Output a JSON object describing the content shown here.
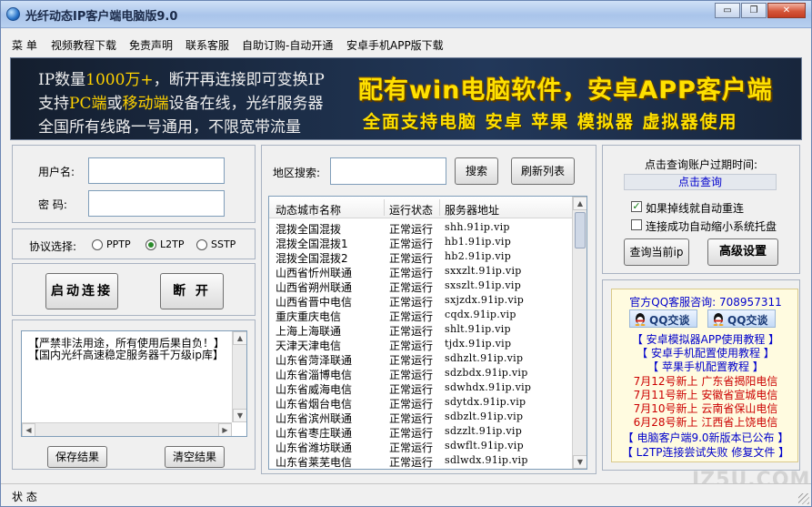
{
  "window": {
    "title": "光纤动态IP客户端电脑版9.0",
    "controls": [
      "▭",
      "❐",
      "✕"
    ]
  },
  "menu": [
    "菜 单",
    "视频教程下载",
    "免责声明",
    "联系客服",
    "自助订购-自动开通",
    "安卓手机APP版下载"
  ],
  "banner": {
    "line1_a": "IP数量",
    "line1_hl": "1000万+",
    "line1_b": "，断开再连接即可变换IP",
    "line2_a": "支持",
    "line2_hl1": "PC端",
    "line2_b": "或",
    "line2_hl2": "移动端",
    "line2_c": "设备在线，光纤服务器",
    "line3": "全国所有线路一号通用，不限宽带流量",
    "headline": "配有win电脑软件，安卓APP客户端",
    "subline": "全面支持电脑 安卓 苹果 模拟器 虚拟器使用"
  },
  "login": {
    "username_label": "用户名:",
    "username_value": "",
    "password_label": "密  码:",
    "password_value": ""
  },
  "protocol": {
    "label": "协议选择:",
    "options": [
      {
        "label": "PPTP",
        "checked": false
      },
      {
        "label": "L2TP",
        "checked": true
      },
      {
        "label": "SSTP",
        "checked": false
      }
    ]
  },
  "actions": {
    "connect": "启动连接",
    "disconnect": "断 开",
    "save": "保存结果",
    "clear": "清空结果"
  },
  "log": [
    "【严禁非法用途，所有使用后果自负！】",
    "【国内光纤高速稳定服务器千万级ip库】"
  ],
  "search": {
    "label": "地区搜索:",
    "value": "",
    "search_button": "搜索",
    "refresh_button": "刷新列表"
  },
  "servers": {
    "columns": [
      "动态城市名称",
      "运行状态",
      "服务器地址"
    ],
    "rows": [
      [
        "混拨全国混拨",
        "正常运行",
        "shh.91ip.vip"
      ],
      [
        "混拨全国混拨1",
        "正常运行",
        "hb1.91ip.vip"
      ],
      [
        "混拨全国混拨2",
        "正常运行",
        "hb2.91ip.vip"
      ],
      [
        "山西省忻州联通",
        "正常运行",
        "sxxzlt.91ip.vip"
      ],
      [
        "山西省朔州联通",
        "正常运行",
        "sxszlt.91ip.vip"
      ],
      [
        "山西省晋中电信",
        "正常运行",
        "sxjzdx.91ip.vip"
      ],
      [
        "重庆重庆电信",
        "正常运行",
        "cqdx.91ip.vip"
      ],
      [
        "上海上海联通",
        "正常运行",
        "shlt.91ip.vip"
      ],
      [
        "天津天津电信",
        "正常运行",
        "tjdx.91ip.vip"
      ],
      [
        "山东省菏泽联通",
        "正常运行",
        "sdhzlt.91ip.vip"
      ],
      [
        "山东省淄博电信",
        "正常运行",
        "sdzbdx.91ip.vip"
      ],
      [
        "山东省威海电信",
        "正常运行",
        "sdwhdx.91ip.vip"
      ],
      [
        "山东省烟台电信",
        "正常运行",
        "sdytdx.91ip.vip"
      ],
      [
        "山东省滨州联通",
        "正常运行",
        "sdbzlt.91ip.vip"
      ],
      [
        "山东省枣庄联通",
        "正常运行",
        "sdzzlt.91ip.vip"
      ],
      [
        "山东省潍坊联通",
        "正常运行",
        "sdwflt.91ip.vip"
      ],
      [
        "山东省莱芜电信",
        "正常运行",
        "sdlwdx.91ip.vip"
      ]
    ]
  },
  "account": {
    "expire_label": "点击查询账户过期时间:",
    "query_link": "点击查询",
    "auto_reconnect": {
      "label": "如果掉线就自动重连",
      "checked": true
    },
    "auto_minimize": {
      "label": "连接成功自动缩小系统托盘",
      "checked": false
    },
    "query_ip_button": "查询当前ip",
    "advanced_button": "高级设置"
  },
  "info": {
    "qq_line": "官方QQ客服咨询: 708957311",
    "qq_button1": "QQ交谈",
    "qq_button2": "QQ交谈",
    "links": [
      "【 安卓模拟器APP使用教程 】",
      "【 安卓手机配置使用教程 】",
      "【 苹果手机配置教程 】"
    ],
    "news": [
      "7月12号新上  广东省揭阳电信",
      "7月11号新上  安徽省宣城电信",
      "7月10号新上  云南省保山电信",
      "6月28号新上  江西省上饶电信"
    ],
    "footer_links": [
      "【 电脑客户端9.0新版本已公布 】",
      "【 L2TP连接尝试失败 修复文件 】"
    ]
  },
  "status": {
    "label": "状 态"
  },
  "watermark": "JZ5U.COM",
  "colors": {
    "link_blue": "#0000cc",
    "news_red": "#cc0000",
    "banner_yellow": "#ffe000",
    "highlight_yellow": "#ffd200",
    "status_green": "#137c13"
  }
}
